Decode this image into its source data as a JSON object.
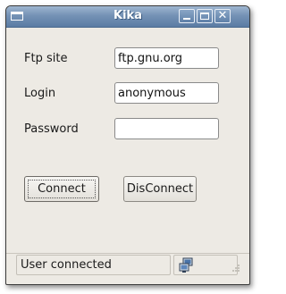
{
  "window": {
    "title": "Kika"
  },
  "form": {
    "ftp_site_label": "Ftp site",
    "ftp_site_value": "ftp.gnu.org",
    "login_label": "Login",
    "login_value": "anonymous",
    "password_label": "Password",
    "password_value": ""
  },
  "buttons": {
    "connect_label": "Connect",
    "disconnect_label": "DisConnect"
  },
  "status": {
    "message": "User connected",
    "icon": "network-connected-icon"
  },
  "colors": {
    "title_bar": "#7492b5",
    "window_bg": "#edeae4"
  }
}
